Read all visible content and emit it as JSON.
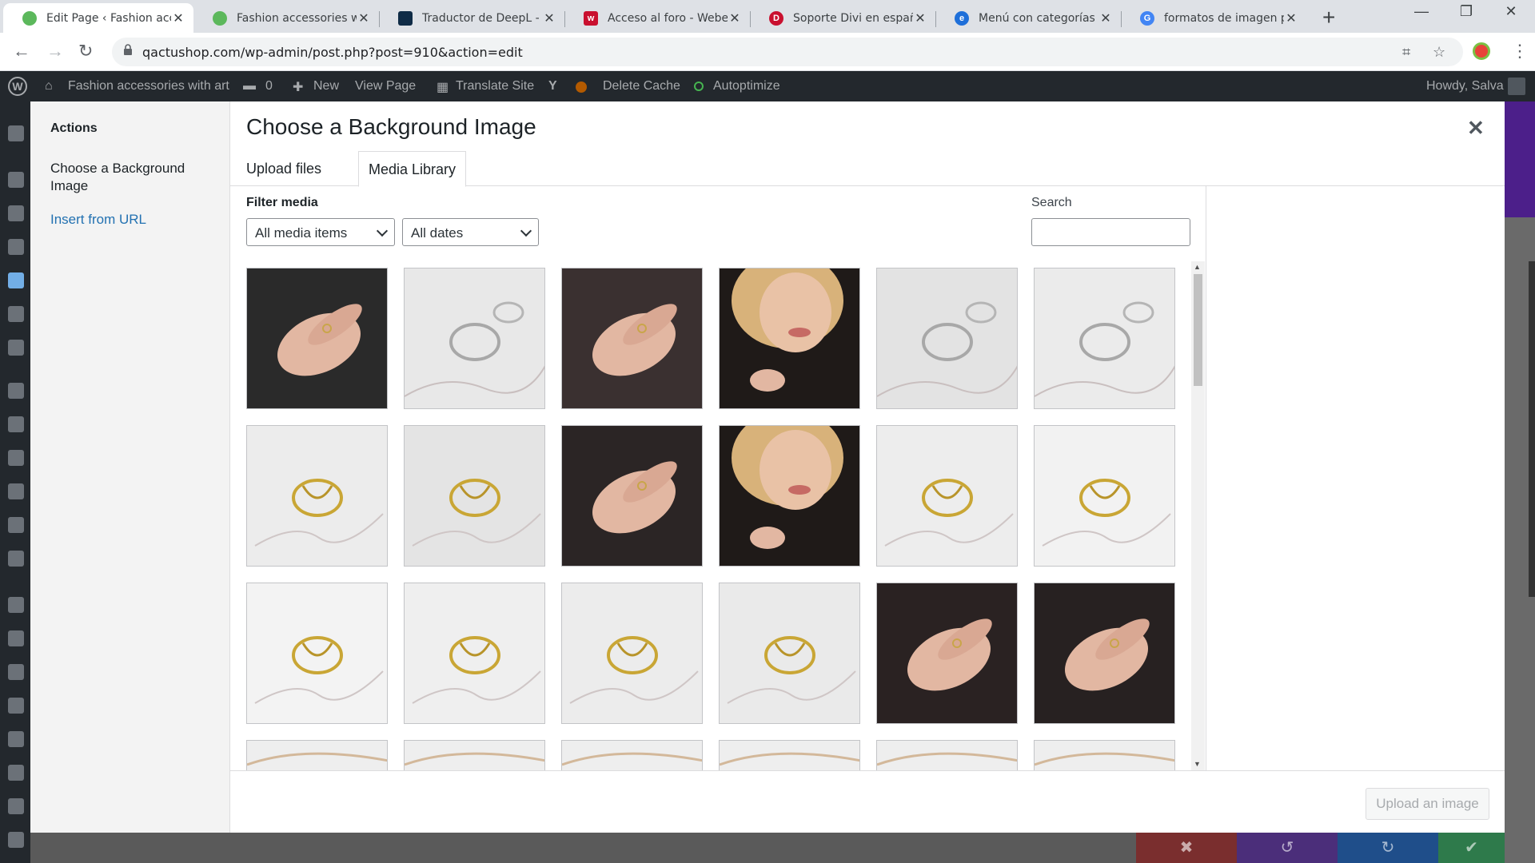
{
  "browser": {
    "tabs": [
      {
        "title": "Edit Page ‹ Fashion acc",
        "favicon_color": "#5cb85c",
        "active": true
      },
      {
        "title": "Fashion accessories wit",
        "favicon_color": "#5cb85c",
        "active": false
      },
      {
        "title": "Traductor de DeepL - D",
        "favicon_color": "#0f2b46",
        "active": false
      },
      {
        "title": "Acceso al foro - Weber",
        "favicon_color": "#c9102f",
        "active": false
      },
      {
        "title": "Soporte Divi en españo",
        "favicon_color": "#c9102f",
        "active": false
      },
      {
        "title": "Menú con categorías d",
        "favicon_color": "#1e6fd9",
        "active": false
      },
      {
        "title": "formatos de imagen pa",
        "favicon_color": "#4285f4",
        "active": false
      }
    ],
    "url": "qactushop.com/wp-admin/post.php?post=910&action=edit"
  },
  "adminbar": {
    "site_name": "Fashion accessories with art",
    "comments_count": "0",
    "new_label": "New",
    "view_page": "View Page",
    "translate_site": "Translate Site",
    "delete_cache": "Delete Cache",
    "autoptimize": "Autoptimize",
    "howdy": "Howdy, Salva"
  },
  "modal": {
    "title": "Choose a Background Image",
    "sidebar": {
      "heading": "Actions",
      "current_item": "Choose a Background Image",
      "link_item": "Insert from URL"
    },
    "tabs": [
      "Upload files",
      "Media Library"
    ],
    "active_tab": "Media Library",
    "filter_label": "Filter media",
    "media_type_select": "All media items",
    "date_select": "All dates",
    "search_label": "Search",
    "search_value": "",
    "upload_button": "Upload an image"
  },
  "media_items": [
    {
      "subject": "hands-on-black",
      "bg": "#2a2a2a"
    },
    {
      "subject": "silver-rings-marble",
      "bg": "#e8e8e8"
    },
    {
      "subject": "hand-on-shoulder",
      "bg": "#3a3030"
    },
    {
      "subject": "face-blonde",
      "bg": "#c9a78a"
    },
    {
      "subject": "silver-rings-marble",
      "bg": "#e3e3e3"
    },
    {
      "subject": "silver-ring-marble",
      "bg": "#ebebeb"
    },
    {
      "subject": "gold-ring-marble",
      "bg": "#ececec"
    },
    {
      "subject": "gold-ring-black-detail",
      "bg": "#e4e4e4"
    },
    {
      "subject": "hands-on-black",
      "bg": "#2b2525"
    },
    {
      "subject": "face-blonde",
      "bg": "#b28c6e"
    },
    {
      "subject": "gold-ring-marble",
      "bg": "#ededed"
    },
    {
      "subject": "gold-ring-white",
      "bg": "#f2f2f2"
    },
    {
      "subject": "gold-ring-white",
      "bg": "#f3f3f3"
    },
    {
      "subject": "gold-rings-white",
      "bg": "#efefef"
    },
    {
      "subject": "gold-ring-marble",
      "bg": "#ececec"
    },
    {
      "subject": "gold-ring-marble",
      "bg": "#eaeaea"
    },
    {
      "subject": "hands-black-rings",
      "bg": "#2a2222"
    },
    {
      "subject": "hands-black-rings",
      "bg": "#272121"
    },
    {
      "subject": "marble",
      "bg": "#eeeeee"
    },
    {
      "subject": "marble",
      "bg": "#eeeeee"
    },
    {
      "subject": "marble",
      "bg": "#eeeeee"
    },
    {
      "subject": "marble",
      "bg": "#eeeeee"
    },
    {
      "subject": "marble",
      "bg": "#eeeeee"
    },
    {
      "subject": "marble",
      "bg": "#eeeeee"
    }
  ]
}
